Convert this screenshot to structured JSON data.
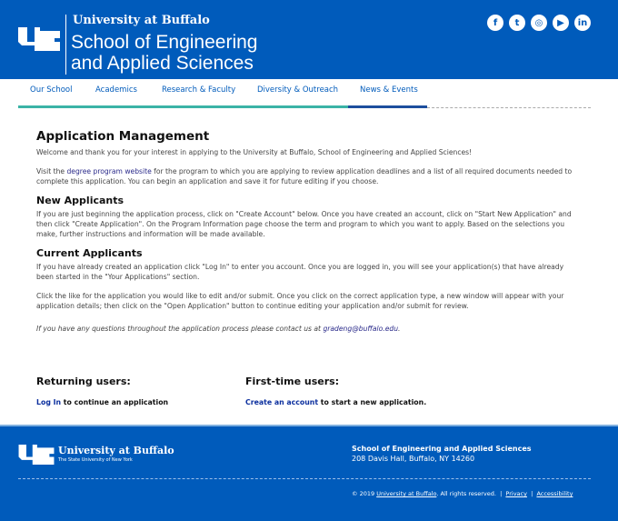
{
  "header": {
    "university": "University at Buffalo",
    "school_line1": "School of Engineering",
    "school_line2": "and Applied Sciences",
    "social": [
      {
        "icon": "facebook-icon",
        "glyph": "f"
      },
      {
        "icon": "twitter-icon",
        "glyph": "t"
      },
      {
        "icon": "instagram-icon",
        "glyph": "◎"
      },
      {
        "icon": "youtube-icon",
        "glyph": "▶"
      },
      {
        "icon": "linkedin-icon",
        "glyph": "in"
      }
    ],
    "brand_color": "#005bbb"
  },
  "nav": [
    "Our School",
    "Academics",
    "Research & Faculty",
    "Diversity & Outreach",
    "News & Events"
  ],
  "main": {
    "title": "Application Management",
    "welcome": "Welcome and thank you for your interest in applying to the University at Buffalo, School of Engineering and Applied Sciences!",
    "visit_pre": "Visit the ",
    "visit_link": "degree program website",
    "visit_post": " for the program to which you are applying to review application deadlines and a list of all required documents needed to complete this application. You can begin an application and save it for future editing if you choose.",
    "new_title": "New Applicants",
    "new_text": "If you are just beginning the application process, click on \"Create Account\" below. Once you have created an account, click on \"Start New Application\" and then click \"Create Application\".  On the Program Information page choose the term and program to which you want to apply.  Based on the selections you make, further instructions and information will be made available.",
    "current_title": "Current Applicants",
    "current_text1": "If you have already created an application click \"Log In\" to enter you account. Once you are logged in, you will see your application(s) that have already been started in the \"Your Applications\" section.",
    "current_text2": "Click the like for the application you would like to edit and/or submit. Once you click on the correct application type, a new window will appear with your application details; then click on the \"Open Application\" button to continue editing your application and/or submit for review.",
    "contact_pre": "If you have any questions throughout the application process please contact us at ",
    "contact_email": "gradeng@buffalo.edu",
    "contact_post": "."
  },
  "returning": {
    "title": "Returning users:",
    "link": "Log In",
    "text": " to continue an application"
  },
  "first_time": {
    "title": "First-time users:",
    "link": "Create an account",
    "text": " to start a new application."
  },
  "footer": {
    "university": "University at Buffalo",
    "tagline": "The State University of New York",
    "school": "School of Engineering and Applied Sciences",
    "address": "208 Davis Hall, Buffalo, NY 14260",
    "copy_pre": "© 2019 ",
    "copy_link": "University at Buffalo",
    "copy_post": ". All rights reserved.  |  ",
    "privacy": "Privacy",
    "sep": "  |  ",
    "accessibility": "Accessibility"
  }
}
